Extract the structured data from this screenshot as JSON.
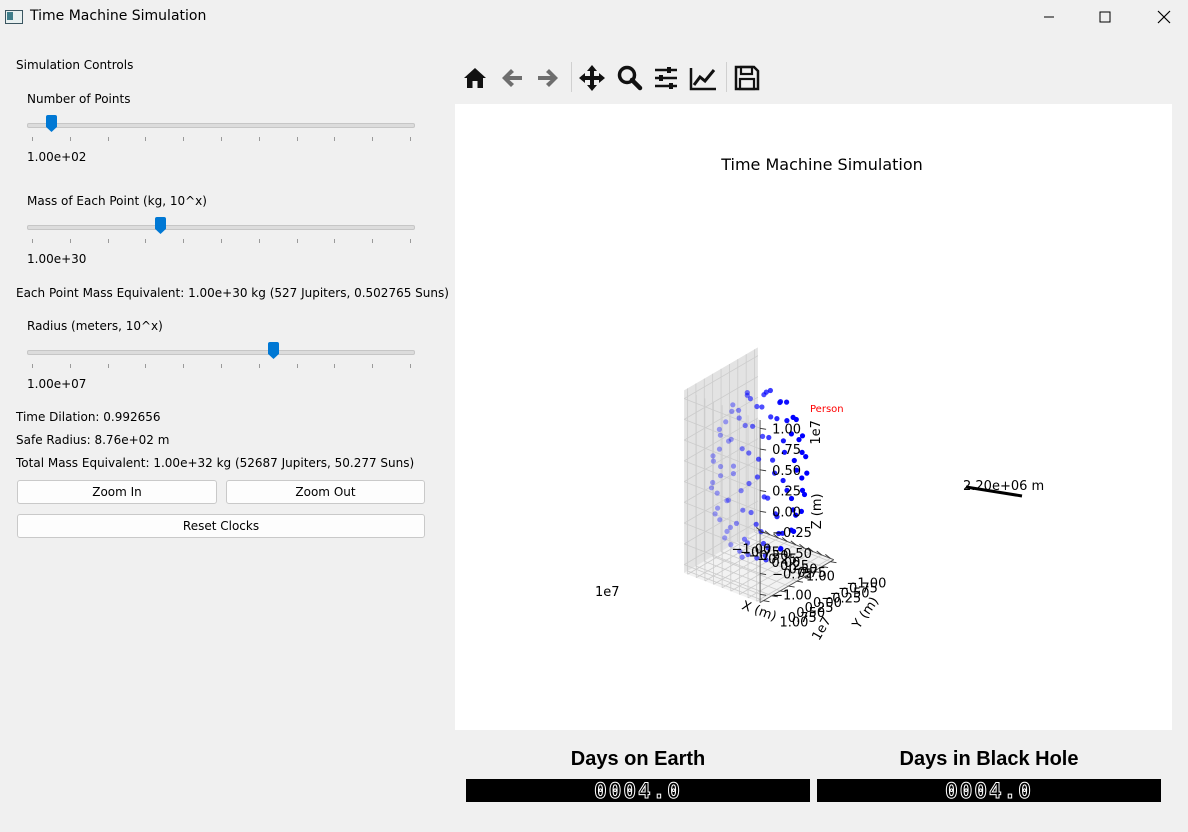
{
  "window": {
    "title": "Time Machine Simulation",
    "icon": "app-icon",
    "controls": [
      "minimize-icon",
      "maximize-icon",
      "close-icon"
    ]
  },
  "controls": {
    "section_title": "Simulation Controls",
    "points": {
      "label": "Number of Points",
      "value_text": "1.00e+02",
      "slider_fraction": 0.05
    },
    "mass": {
      "label": "Mass of Each Point (kg, 10^x)",
      "value_text": "1.00e+30",
      "slider_fraction": 0.34
    },
    "mass_equivalent": "Each Point Mass Equivalent: 1.00e+30 kg (527 Jupiters, 0.502765 Suns)",
    "radius": {
      "label": "Radius (meters, 10^x)",
      "value_text": "1.00e+07",
      "slider_fraction": 0.64
    },
    "time_dilation": "Time Dilation: 0.992656",
    "safe_radius": "Safe Radius: 8.76e+02 m",
    "total_mass": "Total Mass Equivalent: 1.00e+32 kg (52687 Jupiters, 50.277 Suns)",
    "zoom_in": "Zoom In",
    "zoom_out": "Zoom Out",
    "reset_clocks": "Reset Clocks"
  },
  "toolbar": {
    "icons": [
      "home-icon",
      "back-icon",
      "forward-icon",
      "pan-icon",
      "zoom-icon",
      "configure-subplots-icon",
      "edit-axis-icon",
      "save-icon"
    ]
  },
  "chart_data": {
    "type": "scatter",
    "projection": "3d",
    "title": "Time Machine Simulation",
    "xlabel": "X (m)",
    "ylabel": "Y (m)",
    "zlabel": "Z (m)",
    "xlim": [
      -10000000.0,
      10000000.0
    ],
    "ylim": [
      -10000000.0,
      10000000.0
    ],
    "zlim": [
      -10000000.0,
      10000000.0
    ],
    "x_ticks": [
      "−1.00",
      "−0.75",
      "−0.50",
      "−0.25",
      "0.00",
      "0.25",
      "0.50",
      "0.75",
      "1.00"
    ],
    "y_ticks": [
      "−1.00",
      "−0.75",
      "−0.50",
      "−0.25",
      "0.00",
      "0.25",
      "0.50",
      "0.75",
      "1.00"
    ],
    "z_ticks": [
      "−1.00",
      "−0.75",
      "−0.50",
      "−0.25",
      "0.00",
      "0.25",
      "0.50",
      "0.75",
      "1.00"
    ],
    "x_offset": "1e7",
    "y_offset": "1e7",
    "z_offset": "1e7",
    "grid": true,
    "series": [
      {
        "color": "#0000ff",
        "points": "100 points distributed on a sphere of radius 1.00e+07 m"
      }
    ],
    "annotations": [
      {
        "text": "Person",
        "color": "#ff0000"
      },
      {
        "text": "2.20e+06 m",
        "color": "#000000"
      }
    ]
  },
  "clocks": {
    "earth": {
      "title": "Days on Earth",
      "value": "0004.0"
    },
    "black_hole": {
      "title": "Days in Black Hole",
      "value": "0004.0"
    }
  }
}
